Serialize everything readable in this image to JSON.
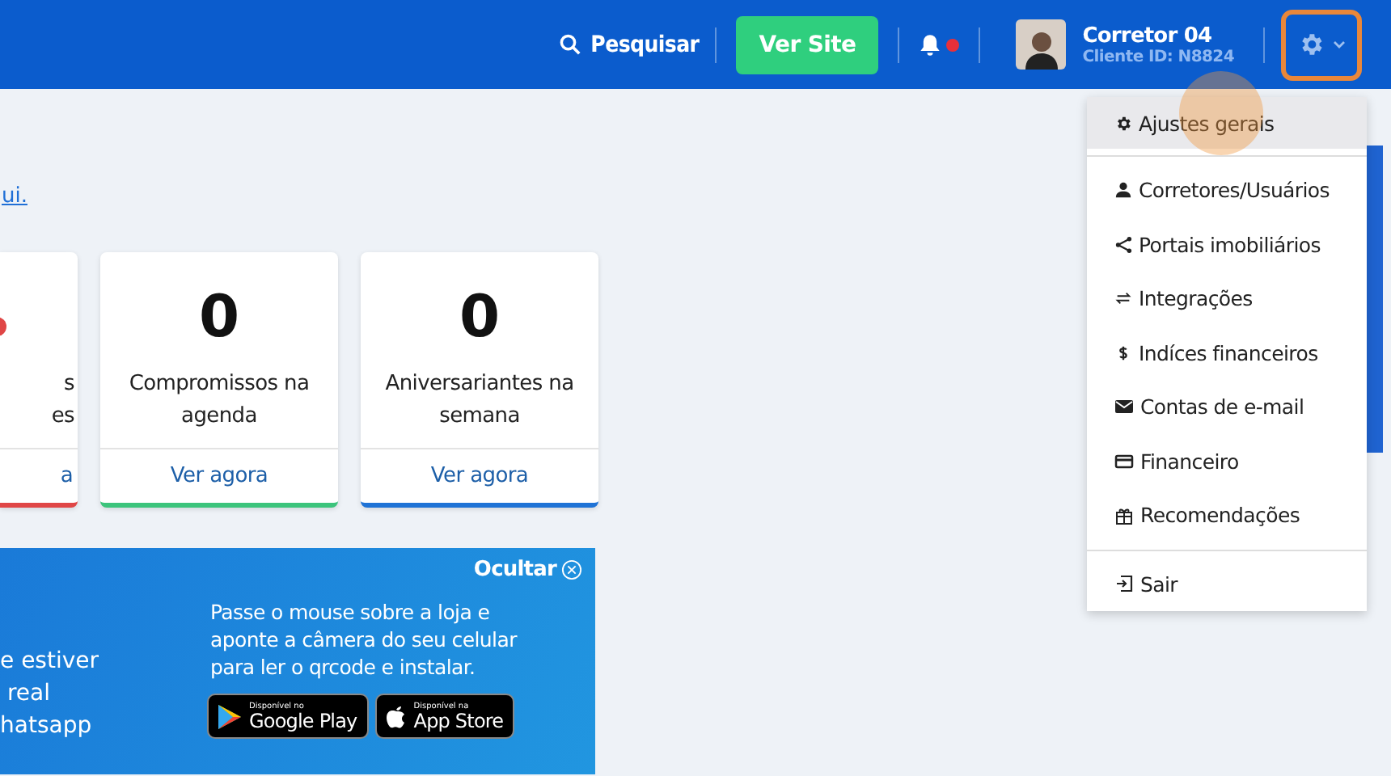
{
  "header": {
    "search_label": "Pesquisar",
    "site_button": "Ver Site",
    "notifications": {
      "unread": true
    },
    "user": {
      "name": "Corretor 04",
      "client_id": "Cliente ID: N8824"
    },
    "settings": {
      "open": true
    }
  },
  "notice": {
    "link": "ui."
  },
  "cards": [
    {
      "label_lines": [
        "s",
        "es"
      ],
      "action": "a",
      "color": "#e04646",
      "alert": true
    },
    {
      "value": "0",
      "label_lines": [
        "Compromissos na",
        "agenda"
      ],
      "action": "Ver agora",
      "color": "#3cc47c",
      "alert": false
    },
    {
      "value": "0",
      "label_lines": [
        "Aniversariantes na",
        "semana"
      ],
      "action": "Ver agora",
      "color": "#1f73d6",
      "alert": false
    }
  ],
  "app_banner": {
    "hide_label": "Ocultar",
    "left_lines": [
      "e estiver",
      " real",
      "hatsapp"
    ],
    "instructions": "Passe o mouse sobre a loja e aponte a câmera do seu celular para ler o qrcode e instalar.",
    "stores": [
      {
        "kind": "google",
        "small": "Disponível no",
        "big": "Google Play"
      },
      {
        "kind": "apple",
        "small": "Disponível na",
        "big": "App Store"
      }
    ]
  },
  "settings_menu": {
    "items": [
      {
        "kind": "gear",
        "label": "Ajustes gerais",
        "selected": true,
        "divider_before": false
      },
      {
        "kind": "user",
        "label": "Corretores/Usuários",
        "selected": false,
        "divider_before": true
      },
      {
        "kind": "share",
        "label": "Portais imobiliários",
        "selected": false,
        "divider_before": false
      },
      {
        "kind": "arrows",
        "label": "Integrações",
        "selected": false,
        "divider_before": false
      },
      {
        "kind": "dollar",
        "label": "Indíces financeiros",
        "selected": false,
        "divider_before": false
      },
      {
        "kind": "mail",
        "label": "Contas de e-mail",
        "selected": false,
        "divider_before": false
      },
      {
        "kind": "card",
        "label": "Financeiro",
        "selected": false,
        "divider_before": false
      },
      {
        "kind": "gift",
        "label": "Recomendações",
        "selected": false,
        "divider_before": false
      },
      {
        "kind": "exit",
        "label": "Sair",
        "selected": false,
        "divider_before": true
      }
    ]
  }
}
